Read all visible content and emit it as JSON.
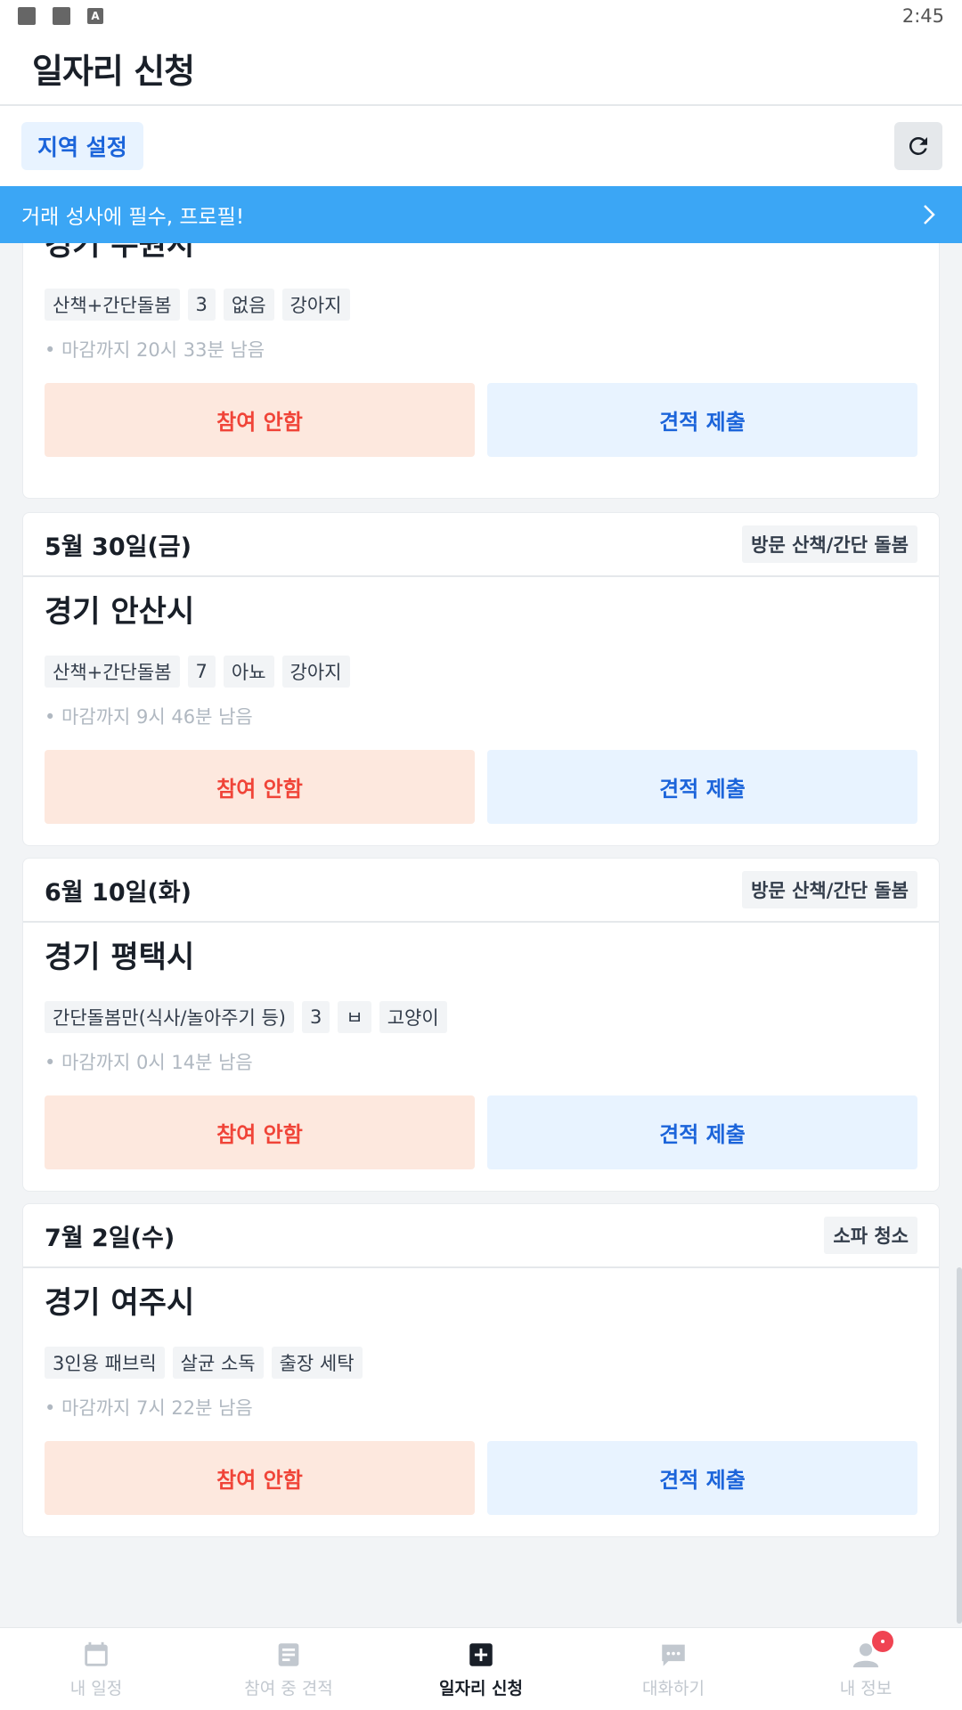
{
  "status_bar": {
    "time": "2:45",
    "a_icon_letter": "A"
  },
  "header": {
    "title": "일자리 신청"
  },
  "toolbar": {
    "region_button": "지역 설정"
  },
  "banner": {
    "text": "거래 성사에 필수, 프로필!"
  },
  "cards": [
    {
      "date": "",
      "service": "",
      "region": "경기 수원시",
      "tags": [
        "산책+간단돌봄",
        "3",
        "없음",
        "강아지"
      ],
      "deadline": "• 마감까지 20시 33분 남음",
      "decline": "참여 안함",
      "quote": "견적 제출"
    },
    {
      "date": "5월 30일(금)",
      "service": "방문 산책/간단 돌봄",
      "region": "경기 안산시",
      "tags": [
        "산책+간단돌봄",
        "7",
        "아뇨",
        "강아지"
      ],
      "deadline": "• 마감까지 9시 46분 남음",
      "decline": "참여 안함",
      "quote": "견적 제출"
    },
    {
      "date": "6월 10일(화)",
      "service": "방문 산책/간단 돌봄",
      "region": "경기 평택시",
      "tags": [
        "간단돌봄만(식사/놀아주기 등)",
        "3",
        "ㅂ",
        "고양이"
      ],
      "deadline": "• 마감까지 0시 14분 남음",
      "decline": "참여 안함",
      "quote": "견적 제출"
    },
    {
      "date": "7월 2일(수)",
      "service": "소파 청소",
      "region": "경기 여주시",
      "tags": [
        "3인용 패브릭",
        "살균 소독",
        "출장 세탁"
      ],
      "deadline": "• 마감까지 7시 22분 남음",
      "decline": "참여 안함",
      "quote": "견적 제출"
    }
  ],
  "nav": [
    {
      "label": "내 일정",
      "icon": "calendar-icon"
    },
    {
      "label": "참여 중 견적",
      "icon": "document-icon"
    },
    {
      "label": "일자리 신청",
      "icon": "plus-square-icon"
    },
    {
      "label": "대화하기",
      "icon": "chat-icon"
    },
    {
      "label": "내 정보",
      "icon": "person-icon"
    }
  ],
  "colors": {
    "accent": "#1b64da",
    "banner": "#3ba6f5",
    "decline": "#f04438",
    "badge": "#f04452"
  }
}
